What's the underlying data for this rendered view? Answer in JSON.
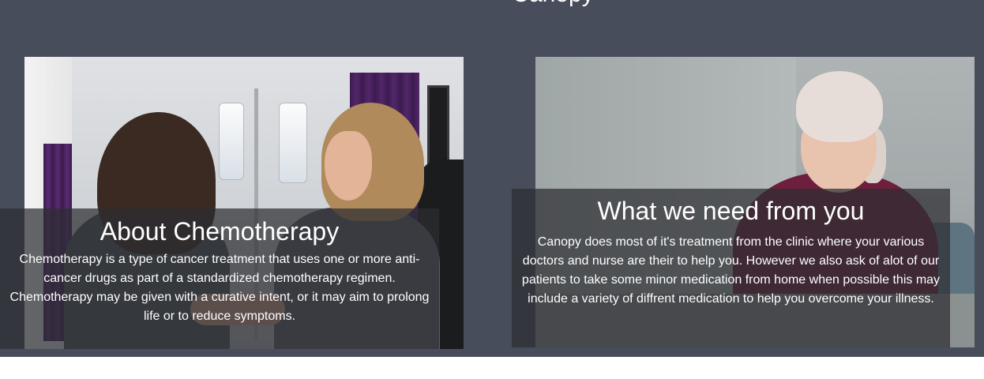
{
  "page": {
    "clipped_heading": "Canopy"
  },
  "cards": [
    {
      "title": "About Chemotherapy",
      "body": "Chemotherapy is a type of cancer treatment that uses one or more anti-cancer drugs as part of a standardized chemotherapy regimen. Chemotherapy may be given with a curative intent, or it may aim to prolong life or to reduce symptoms."
    },
    {
      "title": "What we need from you",
      "body": "Canopy does most of it's treatment from the clinic where your various doctors and nurse are their to help you. However we also ask of alot of our patients to take some minor medication from home when possible this may include a variety of diffrent medication to help you overcome your illness."
    }
  ],
  "colors": {
    "section_background": "#474d5a",
    "overlay": "rgba(44, 46, 50, 0.72)",
    "text": "#ffffff"
  }
}
